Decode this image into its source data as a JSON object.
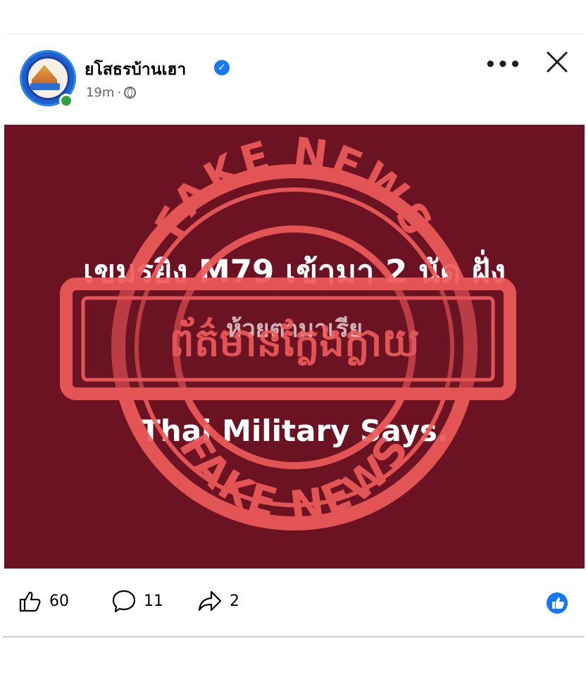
{
  "post": {
    "page_name": "ยโสธรบ้านเฮา",
    "time": "19m",
    "separator": "·",
    "image_text": {
      "line1": "เขมรยิง M79 เข้ามา 2 นัด ฝั่ง",
      "line2": "ห้วยตามาเรีย",
      "line3": "Thai Military Says."
    },
    "stamp": {
      "top_text": "FAKE NEWS",
      "bottom_text": "FAKE NEWS",
      "banner_text": "ព័ត៌មានក្លែងក្លាយ",
      "color": "#ee5a5a"
    }
  },
  "actions": {
    "likes": "60",
    "comments": "11",
    "shares": "2"
  },
  "colors": {
    "image_background": "#6b1322",
    "verified_badge": "#1877f2",
    "online_dot": "#31a24c",
    "secondary_text": "#65676b"
  },
  "icons": [
    "verified-badge-icon",
    "globe-icon",
    "more-options-icon",
    "close-icon",
    "thumbs-up-icon",
    "comment-icon",
    "share-icon",
    "like-reaction-icon"
  ]
}
